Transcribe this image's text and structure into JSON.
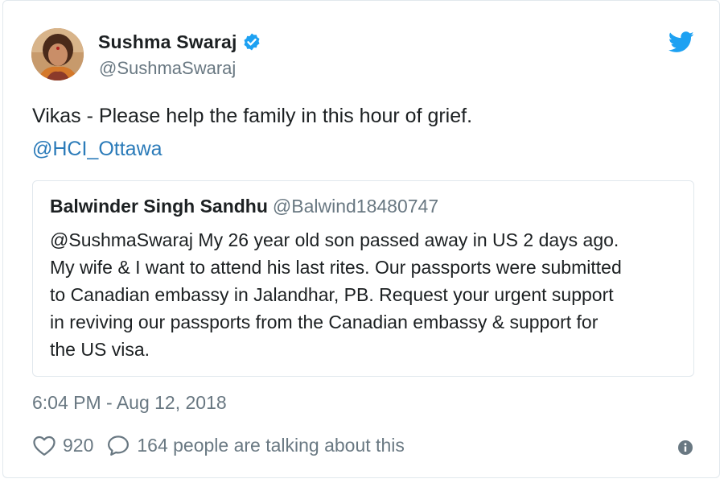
{
  "tweet": {
    "author": {
      "display_name": "Sushma Swaraj",
      "handle": "@SushmaSwaraj",
      "verified": true
    },
    "text": "Vikas - Please help the family in this hour of grief.",
    "mention": "@HCI_Ottawa",
    "quoted": {
      "author_name": "Balwinder Singh Sandhu",
      "author_handle": "@Balwind18480747",
      "lines": [
        "@SushmaSwaraj My 26 year old son passed away in US 2 days ago.",
        "My wife & I want to attend his last rites. Our passports were submitted",
        "to Canadian embassy in Jalandhar, PB. Request your urgent support",
        "in reviving our passports from the Canadian embassy & support for",
        "the US visa."
      ]
    },
    "timestamp": "6:04 PM - Aug 12, 2018",
    "likes": "920",
    "reply_text": "164 people are talking about this"
  },
  "colors": {
    "brand_blue": "#1da1f2",
    "link_blue": "#2b7bb9",
    "muted_gray": "#697882",
    "text_dark": "#1c2022",
    "border": "#e1e8ed"
  },
  "icons": {
    "brand": "twitter-bird-icon",
    "verified": "verified-badge-icon",
    "like": "heart-icon",
    "reply": "speech-bubble-icon",
    "info": "info-icon"
  }
}
